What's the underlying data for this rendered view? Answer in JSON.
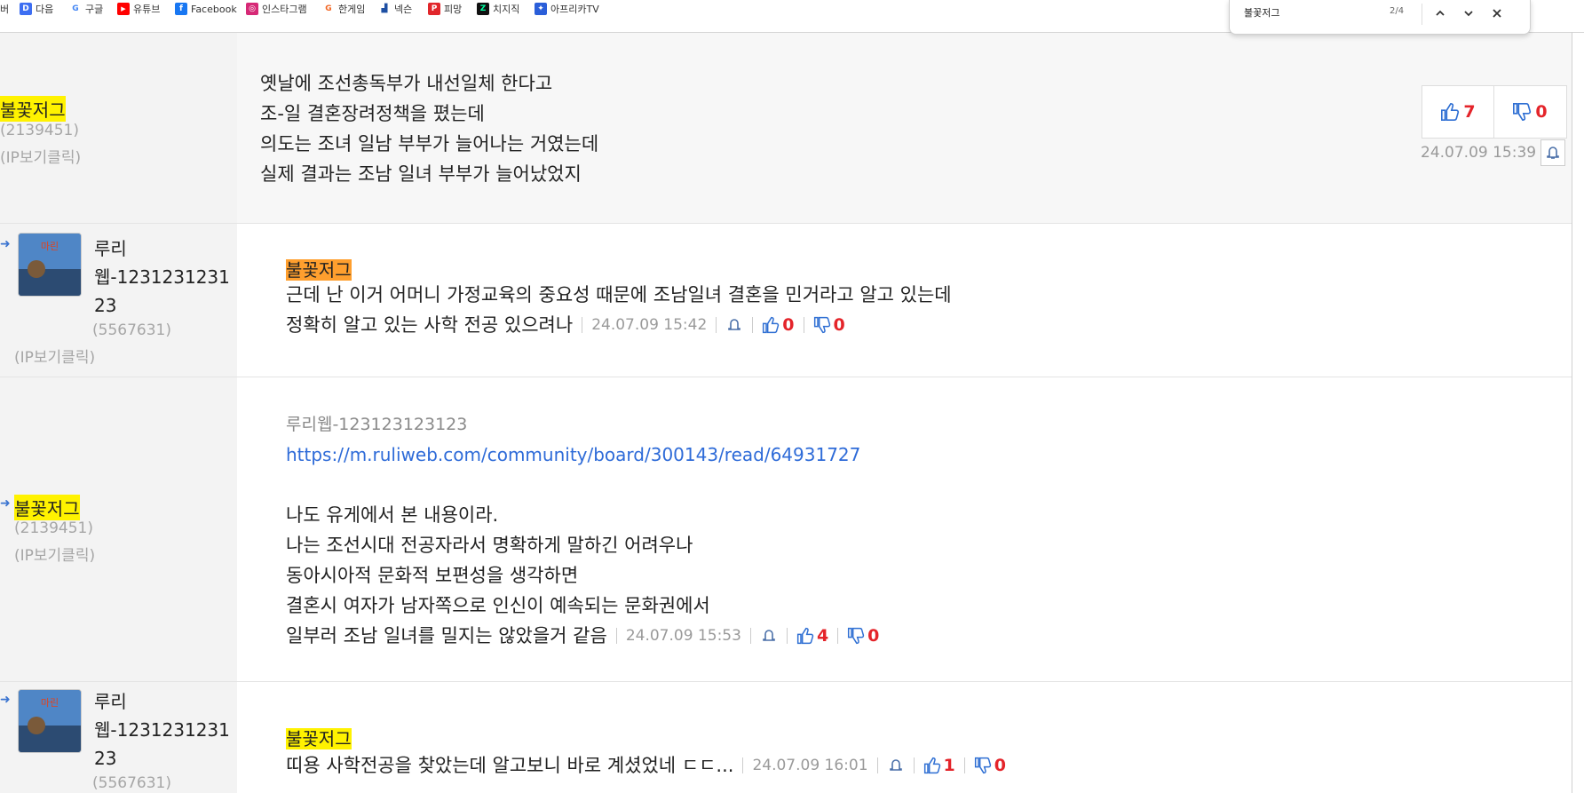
{
  "bookmarks": [
    {
      "label": "버",
      "icon": "naver-icon",
      "color": "#ffffff"
    },
    {
      "label": "다음",
      "icon": "daum-icon",
      "color": "#3d6ef2"
    },
    {
      "label": "구글",
      "icon": "google-icon",
      "color": "#4285f4"
    },
    {
      "label": "유튜브",
      "icon": "youtube-icon",
      "color": "#ff0000"
    },
    {
      "label": "Facebook",
      "icon": "facebook-icon",
      "color": "#1877f2"
    },
    {
      "label": "인스타그램",
      "icon": "instagram-icon",
      "color": "#d62976"
    },
    {
      "label": "한게임",
      "icon": "hangame-icon",
      "color": "#f26522"
    },
    {
      "label": "넥슨",
      "icon": "nexon-icon",
      "color": "#1e4fa3"
    },
    {
      "label": "피망",
      "icon": "pmang-icon",
      "color": "#e1262b"
    },
    {
      "label": "치지직",
      "icon": "chzzk-icon",
      "color": "#111111"
    },
    {
      "label": "아프리카TV",
      "icon": "afreecatv-icon",
      "color": "#2a5ed9"
    }
  ],
  "find": {
    "query": "불꽃저그",
    "count": "2/4"
  },
  "comments": [
    {
      "nick": "불꽃저그",
      "uid": "(2139451)",
      "ip": "(IP보기클릭)",
      "lines": [
        "옛날에 조선총독부가 내선일체 한다고",
        "조-일 결혼장려정책을 폈는데",
        "의도는 조녀 일남 부부가 늘어나는 거였는데",
        "실제 결과는 조남 일녀 부부가 늘어났었지"
      ],
      "time": "24.07.09 15:39",
      "up": "7",
      "down": "0"
    },
    {
      "nick_line1": "루리",
      "nick_line2": "웹-1231231231",
      "nick_line3": "23",
      "uid": "(5567631)",
      "ip": "(IP보기클릭)",
      "reply_to": "불꽃저그",
      "lines": [
        "근데 난 이거 어머니 가정교육의 중요성 때문에 조남일녀 결혼을 민거라고 알고 있는데",
        "정확히 알고 있는 사학 전공 있으려나"
      ],
      "time": "24.07.09 15:42",
      "up": "0",
      "down": "0"
    },
    {
      "nick": "불꽃저그",
      "uid": "(2139451)",
      "ip": "(IP보기클릭)",
      "quote_name": "루리웹-123123123123",
      "link": "https://m.ruliweb.com/community/board/300143/read/64931727",
      "lines": [
        "나도 유게에서 본 내용이라.",
        "나는 조선시대 전공자라서 명확하게 말하긴 어려우나",
        "동아시아적 문화적 보편성을 생각하면",
        "결혼시 여자가 남자쪽으로 인신이 예속되는 문화권에서",
        "일부러 조남 일녀를 밀지는 않았을거 같음"
      ],
      "time": "24.07.09 15:53",
      "up": "4",
      "down": "0"
    },
    {
      "nick_line1": "루리",
      "nick_line2": "웹-1231231231",
      "nick_line3": "23",
      "uid": "(5567631)",
      "reply_to": "불꽃저그",
      "lines": [
        "띠용 사학전공을 찾았는데 알고보니 바로 계셨었네 ㄷㄷ..."
      ],
      "time": "24.07.09 16:01",
      "up": "1",
      "down": "0"
    }
  ]
}
